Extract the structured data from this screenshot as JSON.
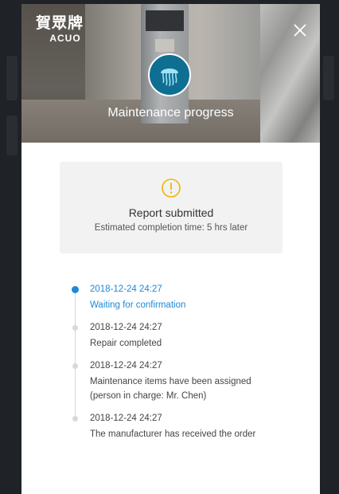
{
  "header": {
    "logo_cn": "賀眾牌",
    "logo_en": "ACUO",
    "title": "Maintenance progress"
  },
  "status": {
    "title": "Report submitted",
    "subtitle": "Estimated completion time: 5 hrs later"
  },
  "timeline": [
    {
      "date": "2018-12-24  24:27",
      "text": "Waiting for confirmation",
      "active": true
    },
    {
      "date": "2018-12-24  24:27",
      "text": "Repair completed",
      "active": false
    },
    {
      "date": "2018-12-24  24:27",
      "text": "Maintenance items have been assigned (person in charge: Mr. Chen)",
      "active": false
    },
    {
      "date": "2018-12-24  24:27",
      "text": "The manufacturer has received the order",
      "active": false
    }
  ],
  "colors": {
    "accent": "#1e88d8",
    "warning": "#f2b400",
    "avatar": "#0f6f92"
  },
  "icons": {
    "close": "close-icon",
    "warning": "warning-icon",
    "avatar": "jellyfish-icon"
  }
}
